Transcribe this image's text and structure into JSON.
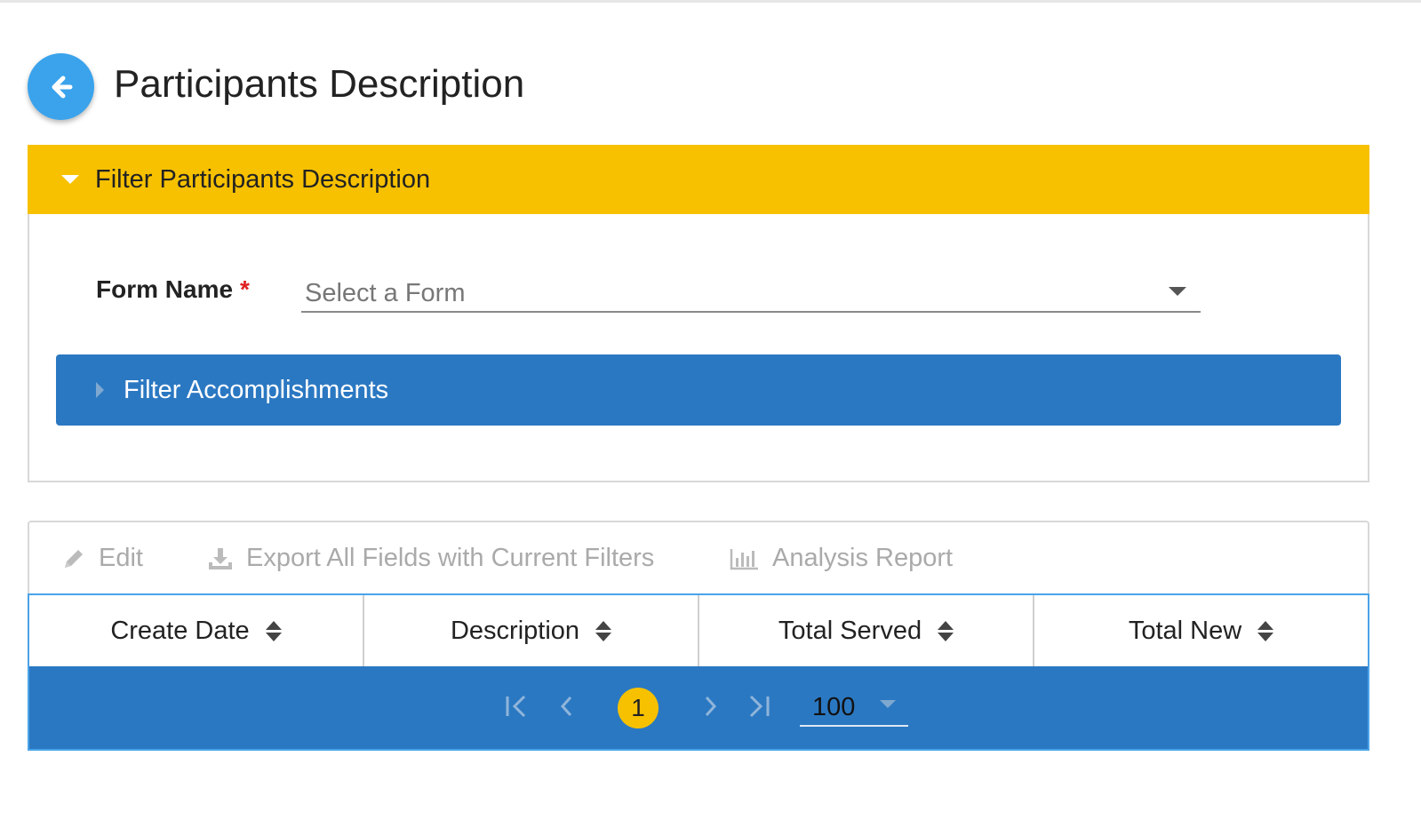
{
  "page": {
    "title": "Participants Description"
  },
  "filter_panel": {
    "header_label": "Filter Participants Description",
    "form_name_label": "Form Name",
    "required_mark": "*",
    "form_select_placeholder": "Select a Form",
    "accomplishments_label": "Filter Accomplishments"
  },
  "toolbar": {
    "edit_label": "Edit",
    "export_label": "Export All Fields with Current Filters",
    "analysis_label": "Analysis Report"
  },
  "grid": {
    "columns": [
      "Create Date",
      "Description",
      "Total Served",
      "Total New"
    ]
  },
  "pager": {
    "current_page": "1",
    "page_size": "100"
  },
  "colors": {
    "accent_yellow": "#f7c100",
    "accent_blue": "#2b78c2",
    "back_button": "#3aa3ec"
  }
}
